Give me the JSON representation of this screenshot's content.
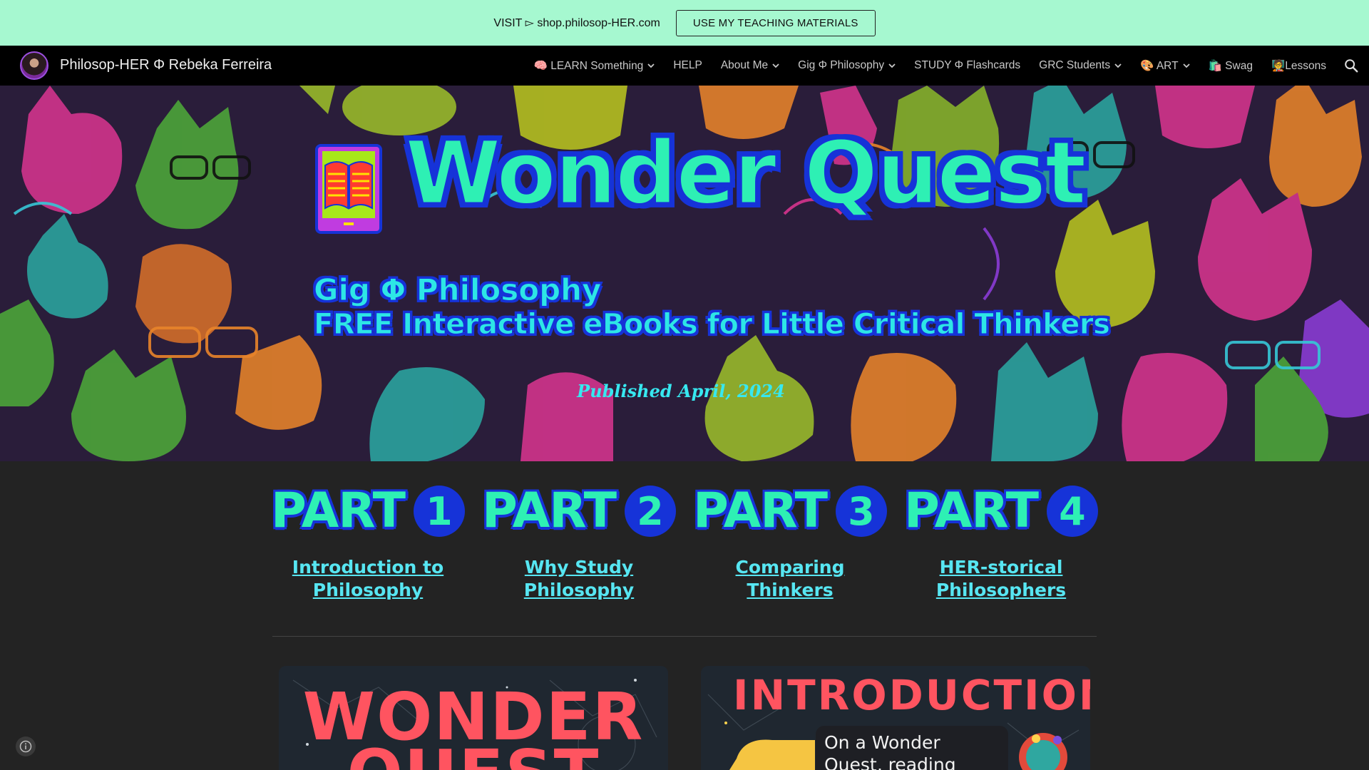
{
  "announcement": {
    "text": "VISIT ▻ shop.philosop-HER.com",
    "button_label": "USE MY TEACHING MATERIALS"
  },
  "navbar": {
    "site_title": "Philosop-HER Φ Rebeka Ferreira",
    "items": [
      {
        "label": "🧠 LEARN Something",
        "has_dropdown": true
      },
      {
        "label": "HELP",
        "has_dropdown": false
      },
      {
        "label": "About Me",
        "has_dropdown": true
      },
      {
        "label": "Gig Φ Philosophy",
        "has_dropdown": true
      },
      {
        "label": "STUDY Φ Flashcards",
        "has_dropdown": false
      },
      {
        "label": "GRC Students",
        "has_dropdown": true
      },
      {
        "label": "🎨 ART",
        "has_dropdown": true
      },
      {
        "label": "🛍️ Swag",
        "has_dropdown": false
      },
      {
        "label": "🧑‍🏫Lessons",
        "has_dropdown": false
      }
    ],
    "search_icon": "search-icon"
  },
  "hero": {
    "title": "Wonder Quest",
    "subtitle_line1": "Gig Φ Philosophy",
    "subtitle_line2": "FREE Interactive eBooks for Little Critical Thinkers",
    "published": "Published April, 2024"
  },
  "parts": [
    {
      "word": "PART",
      "number": "1",
      "link": "Introduction to Philosophy"
    },
    {
      "word": "PART",
      "number": "2",
      "link": "Why Study Philosophy"
    },
    {
      "word": "PART",
      "number": "3",
      "link": "Comparing Thinkers"
    },
    {
      "word": "PART",
      "number": "4",
      "link": "HER-storical Philosophers"
    }
  ],
  "cards": {
    "card1_line1": "WONDER",
    "card1_line2": "QUEST",
    "card2_title": "INTRODUCTION",
    "card2_bubble": "On a Wonder Quest, reading becomes an"
  },
  "colors": {
    "announcement_bg": "#a6f8d0",
    "title_green": "#2ef0b4",
    "outline_blue": "#1633d8",
    "link_cyan": "#57e6f2",
    "card_red": "#ff5460"
  }
}
